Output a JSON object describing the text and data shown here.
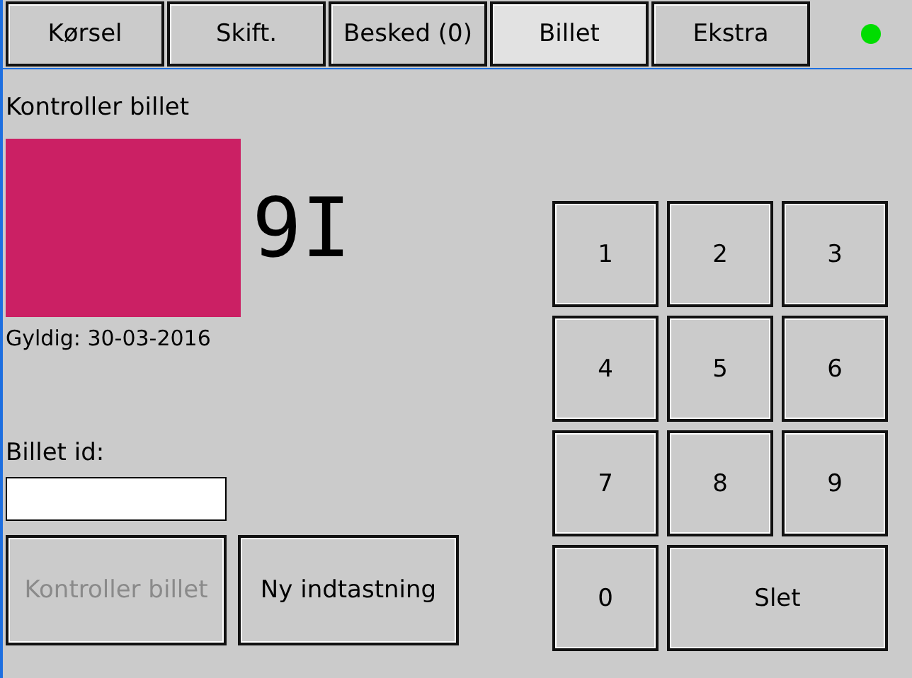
{
  "tabs": [
    {
      "label": "Kørsel",
      "selected": false
    },
    {
      "label": "Skift.",
      "selected": false
    },
    {
      "label": "Besked (0)",
      "selected": false
    },
    {
      "label": "Billet",
      "selected": true
    },
    {
      "label": "Ekstra",
      "selected": false
    }
  ],
  "status": {
    "connected": true
  },
  "ticket": {
    "heading": "Kontroller billet",
    "color": "#cb2064",
    "zone": "9I",
    "valid": "Gyldig: 30-03-2016"
  },
  "ticket_id": {
    "label": "Billet id:"
  },
  "buttons": [
    {
      "label": "Kontroller billet",
      "disabled": true
    },
    {
      "label": "Ny indtastning",
      "disabled": false
    }
  ],
  "keypad": [
    {
      "kind": "digit",
      "label": "1"
    },
    {
      "kind": "digit",
      "label": "2"
    },
    {
      "kind": "digit",
      "label": "3"
    },
    {
      "kind": "digit",
      "label": "4"
    },
    {
      "kind": "digit",
      "label": "5"
    },
    {
      "kind": "digit",
      "label": "6"
    },
    {
      "kind": "digit",
      "label": "7"
    },
    {
      "kind": "digit",
      "label": "8"
    },
    {
      "kind": "digit",
      "label": "9"
    },
    {
      "kind": "digit",
      "label": "0"
    },
    {
      "kind": "delete",
      "label": "Slet"
    }
  ]
}
